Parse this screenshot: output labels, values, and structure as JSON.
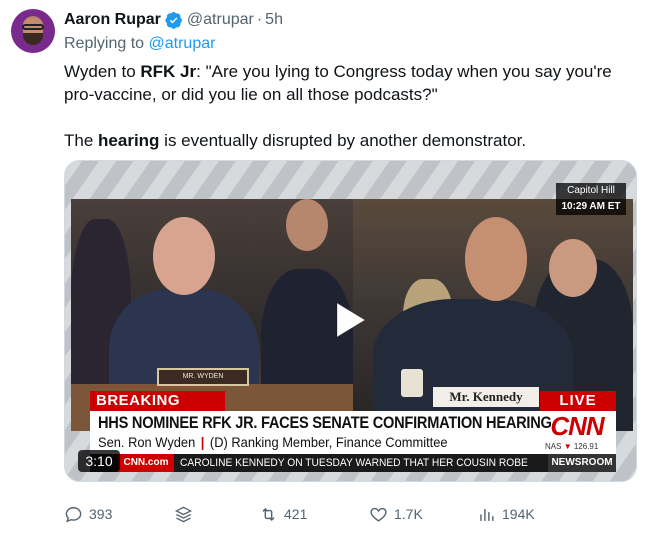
{
  "tweet": {
    "author_name": "Aaron Rupar",
    "handle": "@atrupar",
    "separator": "·",
    "time": "5h",
    "replying_prefix": "Replying to",
    "replying_to": "@atrupar",
    "line1_a": "Wyden to ",
    "line1_b": "RFK Jr",
    "line1_c": ": \"Are you lying to Congress today when you say you're pro-vaccine, or did you lie on all those podcasts?\"",
    "line2_a": "The ",
    "line2_b": "hearing",
    "line2_c": " is eventually disrupted by another demonstrator."
  },
  "video": {
    "duration": "3:10",
    "location_badge": "Capitol Hill",
    "time_badge": "10:29 AM ET",
    "left_nameplate": "MR. WYDEN",
    "right_nameplate": "Mr. Kennedy",
    "breaking_label": "BREAKING NEWS",
    "live_label": "LIVE",
    "headline": "HHS NOMINEE RFK JR. FACES SENATE CONFIRMATION HEARING",
    "sub_name": "Sen. Ron Wyden",
    "sub_sep": "|",
    "sub_role": "(D) Ranking Member, Finance Committee",
    "network_logo": "CNN",
    "market_label": "NAS",
    "market_arrow": "▼",
    "market_value": "126.91",
    "ticker_logo": "CNN.com",
    "ticker_text": "CAROLINE KENNEDY ON TUESDAY WARNED THAT HER COUSIN ROBE",
    "ticker_brand": "NEWSROOM"
  },
  "actions": {
    "replies": "393",
    "retweets": "421",
    "likes": "1.7K",
    "views": "194K"
  },
  "colors": {
    "accent": "#1d9bf0",
    "muted": "#536471",
    "cnn_red": "#cc0000"
  }
}
